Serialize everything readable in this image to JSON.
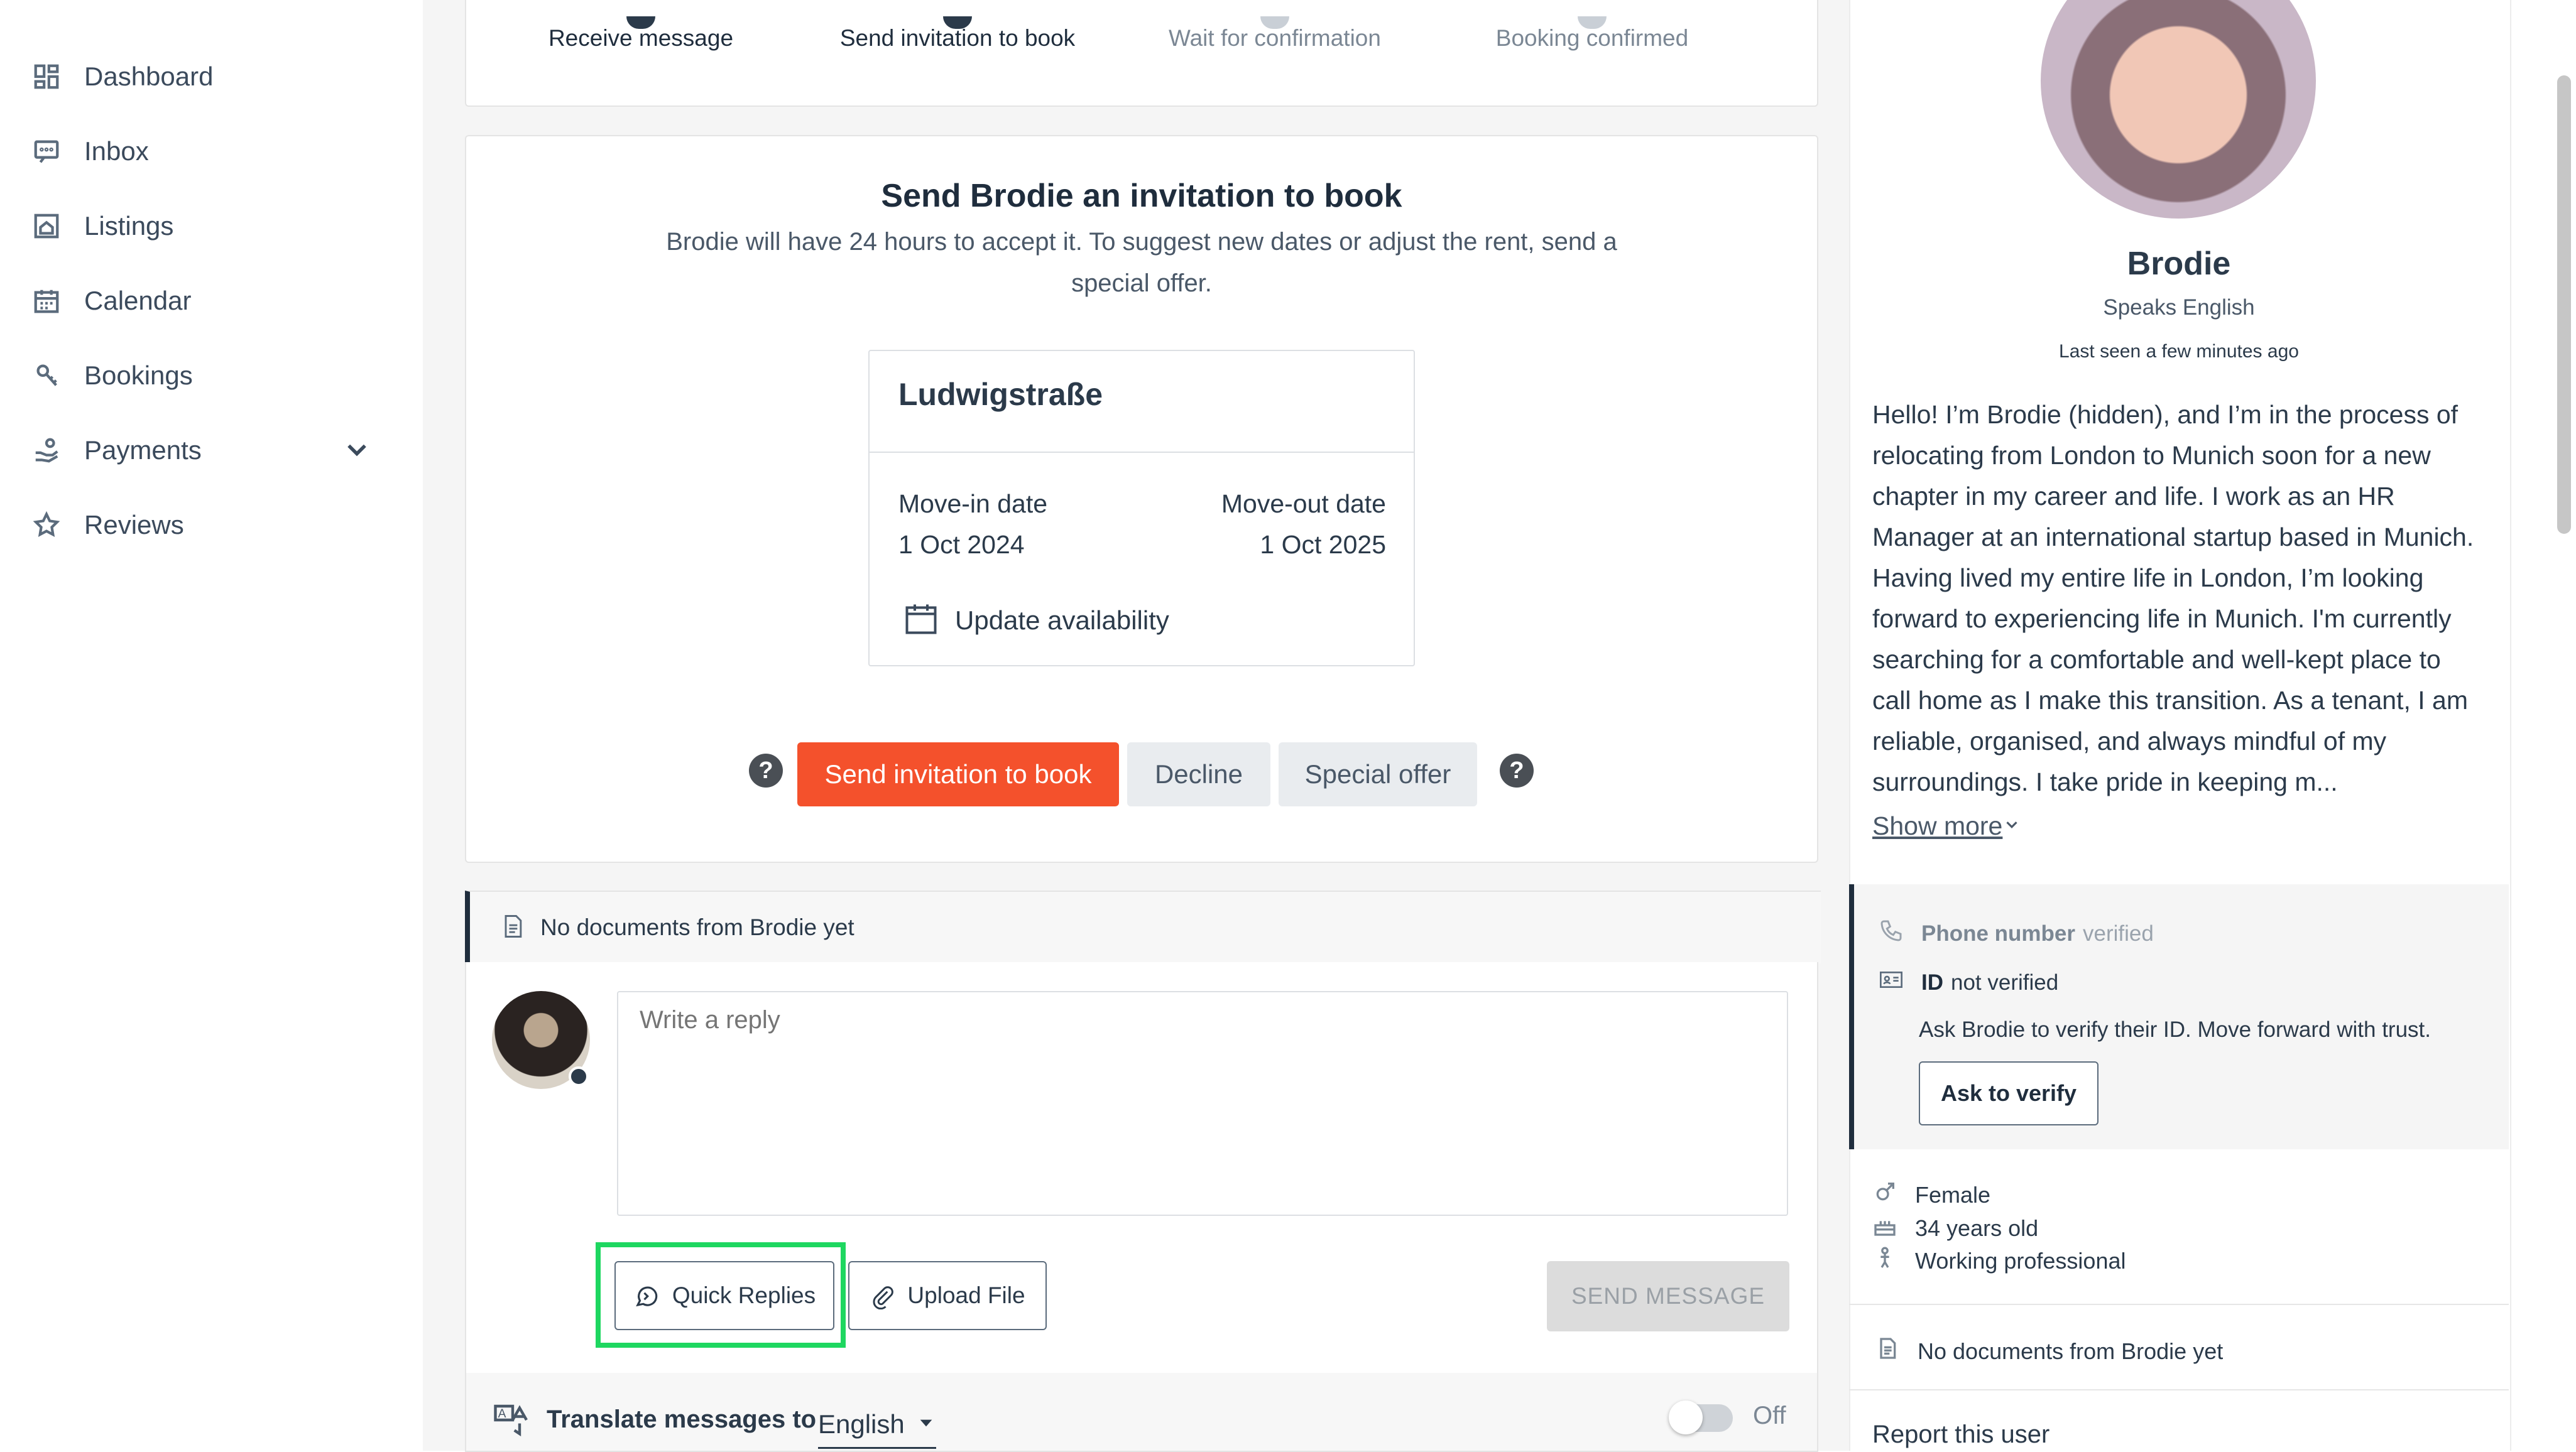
{
  "sidebar": {
    "items": [
      {
        "label": "Dashboard",
        "icon": "dashboard-icon"
      },
      {
        "label": "Inbox",
        "icon": "inbox-icon"
      },
      {
        "label": "Listings",
        "icon": "listings-icon"
      },
      {
        "label": "Calendar",
        "icon": "calendar-icon"
      },
      {
        "label": "Bookings",
        "icon": "bookings-icon"
      },
      {
        "label": "Payments",
        "icon": "payments-icon"
      },
      {
        "label": "Reviews",
        "icon": "star-icon"
      }
    ]
  },
  "steps": [
    "Receive message",
    "Send invitation to book",
    "Wait for confirmation",
    "Booking confirmed"
  ],
  "invitation": {
    "title": "Send Brodie an invitation to book",
    "subtitle_line1": "Brodie will have 24 hours to accept it. To suggest new dates or adjust the rent, send a",
    "subtitle_line2": "special offer.",
    "listing": {
      "name": "Ludwigstraße",
      "move_in_label": "Move-in date",
      "move_in_value": "1 Oct 2024",
      "move_out_label": "Move-out date",
      "move_out_value": "1 Oct 2025",
      "update_label": "Update availability"
    },
    "send_label": "Send invitation to book",
    "decline_label": "Decline",
    "special_offer_label": "Special offer",
    "help": "?"
  },
  "documents_note": "No documents from Brodie yet",
  "reply": {
    "placeholder": "Write a reply",
    "quick_replies_label": "Quick Replies",
    "upload_label": "Upload File",
    "send_message_label": "SEND MESSAGE"
  },
  "translate": {
    "label": "Translate messages to",
    "language": "English",
    "toggle_state": "Off"
  },
  "profile": {
    "name": "Brodie",
    "speaks": "Speaks English",
    "last_seen": "Last seen a few minutes ago",
    "bio_lines": [
      "Hello! I’m Brodie (hidden), and I’m in the process of",
      "relocating from London to Munich soon for a new",
      "chapter in my career and life. I work as an HR",
      "Manager at an international startup based in Munich.",
      "Having lived my entire life in London, I’m looking",
      "forward to experiencing life in Munich. I'm currently",
      "searching for a comfortable and well-kept place to",
      "call home as I make this transition. As a tenant, I am",
      "reliable, organised, and always mindful of my",
      "surroundings. I take pride in keeping m..."
    ],
    "show_more": "Show more",
    "phone_label": "Phone number",
    "phone_status": "verified",
    "id_label": "ID",
    "id_status": "not verified",
    "verify_note": "Ask Brodie to verify their ID. Move forward with trust.",
    "ask_verify_label": "Ask to verify",
    "gender": "Female",
    "age": "34 years old",
    "occupation": "Working professional",
    "documents_note": "No documents from Brodie yet",
    "report": "Report this user"
  },
  "colors": {
    "accent": "#f4512c",
    "highlight": "#1ed760",
    "muted_button": "#e9ecef",
    "disabled_button": "#dcdcdc"
  }
}
